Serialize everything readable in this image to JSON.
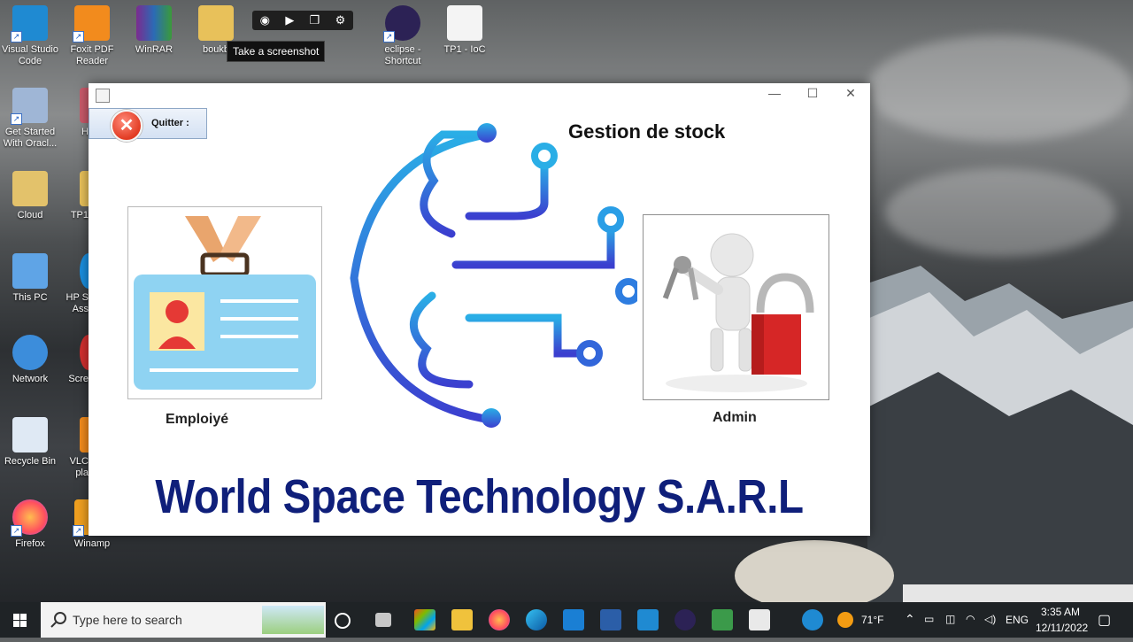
{
  "desktop": {
    "icons": [
      {
        "label": "Visual Studio Code",
        "line1": "Visual Studio",
        "line2": "Code"
      },
      {
        "label": "Foxit PDF Reader",
        "line1": "Foxit PDF",
        "line2": "Reader"
      },
      {
        "label": "WinRAR",
        "line1": "WinRAR",
        "line2": ""
      },
      {
        "label": "boukb",
        "line1": "boukb",
        "line2": ""
      },
      {
        "label": "eclipse - Shortcut",
        "line1": "eclipse -",
        "line2": "Shortcut"
      },
      {
        "label": "TP1 - IoC",
        "line1": "TP1 - IoC",
        "line2": ""
      },
      {
        "label": "Get Started With Oracl...",
        "line1": "Get Started",
        "line2": "With Oracl..."
      },
      {
        "label": "H",
        "line1": "H",
        "line2": ""
      },
      {
        "label": "Cloud",
        "line1": "Cloud",
        "line2": ""
      },
      {
        "label": "TP1",
        "line1": "TP1",
        "line2": ""
      },
      {
        "label": "This PC",
        "line1": "This PC",
        "line2": ""
      },
      {
        "label": "HP S... Assi...",
        "line1": "HP S",
        "line2": "Ass"
      },
      {
        "label": "Network",
        "line1": "Network",
        "line2": ""
      },
      {
        "label": "Scre",
        "line1": "Scre",
        "line2": ""
      },
      {
        "label": "Recycle Bin",
        "line1": "Recycle Bin",
        "line2": ""
      },
      {
        "label": "VLC pla",
        "line1": "VLC",
        "line2": "pla"
      },
      {
        "label": "Firefox",
        "line1": "Firefox",
        "line2": ""
      },
      {
        "label": "Winamp",
        "line1": "Winamp",
        "line2": ""
      }
    ]
  },
  "snip_tool": {
    "tooltip": "Take a screenshot",
    "camera_icon": "camera-icon",
    "video_icon": "video-icon",
    "window_icon": "window-icon",
    "settings_icon": "gear-icon"
  },
  "app": {
    "title": "Gestion de stock",
    "quit_label": "Quitter :",
    "employee_label": "Emploiyé",
    "admin_label": "Admin",
    "company_name": "World Space Technology S.A.R.L",
    "window_controls": {
      "minimize": "—",
      "maximize": "☐",
      "close": "✕"
    },
    "colors": {
      "company_name": "#0f1f7a",
      "logo_gradient_start": "#2aaee6",
      "logo_gradient_end": "#3b3fcf"
    }
  },
  "taskbar": {
    "search_placeholder": "Type here to search",
    "weather": "71°F",
    "language": "ENG",
    "time": "3:35 AM",
    "date": "12/11/2022"
  }
}
